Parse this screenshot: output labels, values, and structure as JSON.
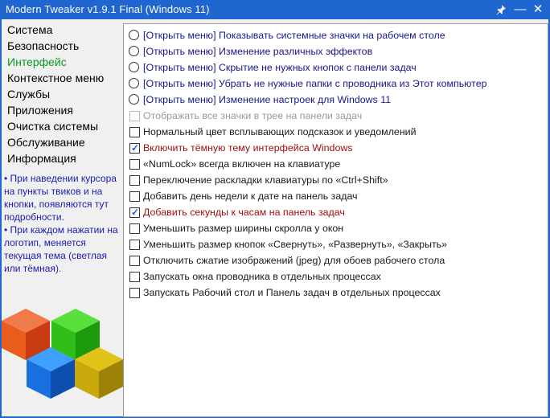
{
  "titlebar": {
    "title": "Modern Tweaker v1.9.1 Final (Windows 11)",
    "pin_glyph": "📌",
    "min_glyph": "—",
    "close_glyph": "✕"
  },
  "sidebar": {
    "items": [
      {
        "label": "Система",
        "active": false
      },
      {
        "label": "Безопасность",
        "active": false
      },
      {
        "label": "Интерфейс",
        "active": true
      },
      {
        "label": "Контекстное меню",
        "active": false
      },
      {
        "label": "Службы",
        "active": false
      },
      {
        "label": "Приложения",
        "active": false
      },
      {
        "label": "Очистка системы",
        "active": false
      },
      {
        "label": "Обслуживание",
        "active": false
      },
      {
        "label": "Информация",
        "active": false
      }
    ],
    "info": [
      "• При наведении курсора на пункты твиков и на кнопки, появляются тут подробности.",
      "• При каждом нажатии на логотип, меняется текущая тема (светлая или тёмная)."
    ],
    "logo_icon": "colored-cubes-logo"
  },
  "options": [
    {
      "type": "radio",
      "label": "[Открыть меню] Показывать системные значки на рабочем столе",
      "state": "blue"
    },
    {
      "type": "radio",
      "label": "[Открыть меню] Изменение различных эффектов",
      "state": "blue"
    },
    {
      "type": "radio",
      "label": "[Открыть меню] Скрытие не нужных кнопок с панели задач",
      "state": "blue"
    },
    {
      "type": "radio",
      "label": "[Открыть меню] Убрать не нужные папки с проводника из Этот компьютер",
      "state": "blue"
    },
    {
      "type": "radio",
      "label": "[Открыть меню] Изменение настроек для Windows 11",
      "state": "blue"
    },
    {
      "type": "check",
      "label": "Отображать все значки в трее на панели задач",
      "checked": false,
      "state": "gray"
    },
    {
      "type": "check",
      "label": "Нормальный цвет всплывающих подсказок и уведомлений",
      "checked": false,
      "state": "black"
    },
    {
      "type": "check",
      "label": "Включить тёмную тему интерфейса Windows",
      "checked": true,
      "state": "red"
    },
    {
      "type": "check",
      "label": "«NumLock» всегда включен на клавиатуре",
      "checked": false,
      "state": "black"
    },
    {
      "type": "check",
      "label": "Переключение раскладки клавиатуры по «Ctrl+Shift»",
      "checked": false,
      "state": "black"
    },
    {
      "type": "check",
      "label": "Добавить день недели к дате на панель задач",
      "checked": false,
      "state": "black"
    },
    {
      "type": "check",
      "label": "Добавить секунды к часам на панель задач",
      "checked": true,
      "state": "red"
    },
    {
      "type": "check",
      "label": "Уменьшить размер ширины скролла у окон",
      "checked": false,
      "state": "black"
    },
    {
      "type": "check",
      "label": "Уменьшить размер кнопок «Свернуть», «Развернуть», «Закрыть»",
      "checked": false,
      "state": "black"
    },
    {
      "type": "check",
      "label": "Отключить сжатие изображений (jpeg) для обоев рабочего стола",
      "checked": false,
      "state": "black"
    },
    {
      "type": "check",
      "label": "Запускать окна проводника в отдельных процессах",
      "checked": false,
      "state": "black"
    },
    {
      "type": "check",
      "label": "Запускать Рабочий стол и Панель задач в отдельных процессах",
      "checked": false,
      "state": "black"
    }
  ],
  "colors": {
    "titlebar": "#1f66d1",
    "active_nav": "#0a9a1a",
    "info_text": "#1b1bb5",
    "radio_text": "#17178e",
    "checked_text": "#a01010",
    "disabled_text": "#9a9a9a"
  }
}
